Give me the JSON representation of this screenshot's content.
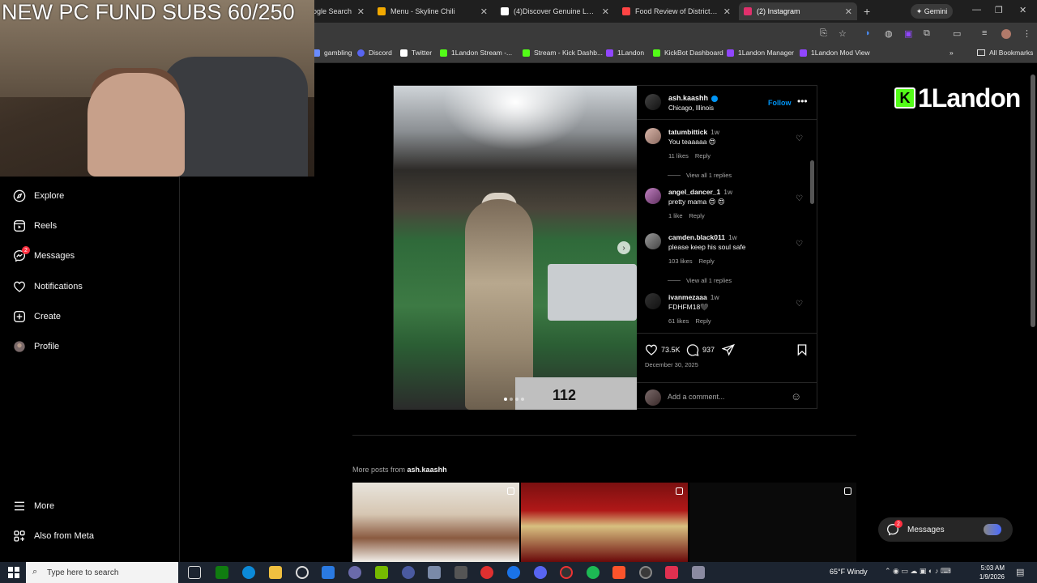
{
  "stream_overlay": {
    "title_text": "NEW PC FUND SUBS 60/250",
    "logo_text": "1Landon",
    "logo_letter": "K"
  },
  "browser": {
    "tabs": [
      {
        "label": "ogle Search",
        "active": false,
        "color": "#4285f4"
      },
      {
        "label": "Menu - Skyline Chili",
        "active": false,
        "color": "#f2a900"
      },
      {
        "label": "(4)Discover Genuine Louisian",
        "active": false,
        "color": "#ffffff"
      },
      {
        "label": "Food Review of District 6 Vie",
        "active": false,
        "color": "#ff4444"
      },
      {
        "label": "(2) Instagram",
        "active": true,
        "color": "#e1306c"
      }
    ],
    "gemini_label": "Gemini",
    "bookmarks": [
      {
        "label": "gambling",
        "color": "#6a8cff"
      },
      {
        "label": "Discord",
        "color": "#5865f2"
      },
      {
        "label": "Twitter",
        "color": "#ffffff"
      },
      {
        "label": "1Landon Stream -...",
        "color": "#53fc18"
      },
      {
        "label": "Stream - Kick Dashb...",
        "color": "#53fc18"
      },
      {
        "label": "1Landon",
        "color": "#9146ff"
      },
      {
        "label": "KickBot Dashboard",
        "color": "#53fc18"
      },
      {
        "label": "1Landon Manager",
        "color": "#9146ff"
      },
      {
        "label": "1Landon Mod View",
        "color": "#9146ff"
      }
    ],
    "all_bookmarks_label": "All Bookmarks"
  },
  "nav": {
    "items": [
      {
        "label": "Explore",
        "icon": "compass-icon"
      },
      {
        "label": "Reels",
        "icon": "reels-icon"
      },
      {
        "label": "Messages",
        "icon": "messenger-icon",
        "badge": "2"
      },
      {
        "label": "Notifications",
        "icon": "heart-icon"
      },
      {
        "label": "Create",
        "icon": "plus-square-icon"
      },
      {
        "label": "Profile",
        "icon": "avatar-icon"
      }
    ],
    "bottom": [
      {
        "label": "More",
        "icon": "hamburger-icon"
      },
      {
        "label": "Also from Meta",
        "icon": "meta-icon"
      }
    ]
  },
  "post": {
    "author": "ash.kaashh",
    "location": "Chicago, Illinois",
    "follow_label": "Follow",
    "image_caption_text": "112",
    "likes": "73.5K",
    "comments_count": "937",
    "date": "December 30, 2025",
    "add_comment_placeholder": "Add a comment...",
    "comments": [
      {
        "user": "tatumbittick",
        "time": "1w",
        "text": "You teaaaaa 😍",
        "likes": "11 likes",
        "reply": "Reply",
        "view_replies": "View all 1 replies"
      },
      {
        "user": "angel_dancer_1",
        "time": "1w",
        "text": "pretty mama 😍 😍",
        "likes": "1 like",
        "reply": "Reply",
        "view_replies": ""
      },
      {
        "user": "camden.black011",
        "time": "1w",
        "text": "please keep his soul safe",
        "likes": "103 likes",
        "reply": "Reply",
        "view_replies": "View all 1 replies"
      },
      {
        "user": "ivanmezaaa",
        "time": "1w",
        "text": "FDHFM18🖤",
        "likes": "61 likes",
        "reply": "Reply",
        "view_replies": ""
      }
    ]
  },
  "more_posts": {
    "prefix": "More posts from",
    "user": "ash.kaashh"
  },
  "messages_pill": {
    "label": "Messages",
    "badge": "2"
  },
  "taskbar": {
    "search_placeholder": "Type here to search",
    "weather": "65°F  Windy",
    "time": "5:03 AM",
    "date": "1/9/2026"
  }
}
